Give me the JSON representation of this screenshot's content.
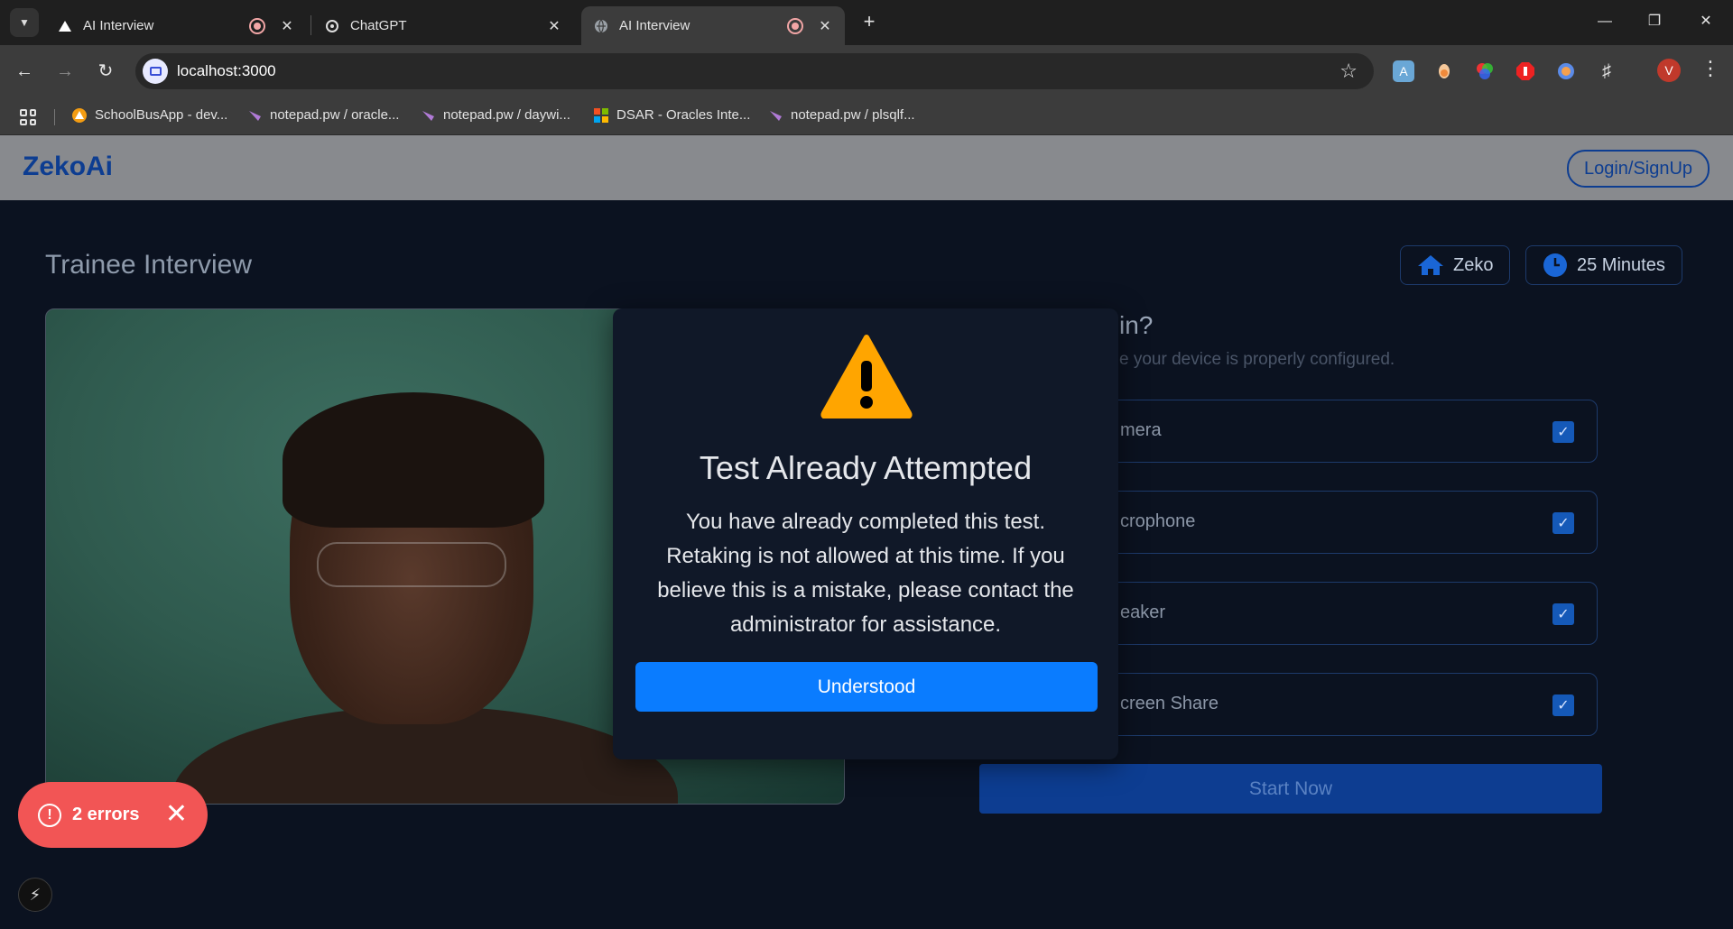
{
  "browser": {
    "tabs": [
      {
        "title": "AI Interview",
        "recording": true,
        "active": false
      },
      {
        "title": "ChatGPT",
        "recording": false,
        "active": false
      },
      {
        "title": "AI Interview",
        "recording": true,
        "active": true
      }
    ],
    "url": "localhost:3000",
    "profile_initial": "V",
    "bookmarks": [
      {
        "label": "SchoolBusApp - dev...",
        "icon": "warning-triangle-icon"
      },
      {
        "label": "notepad.pw / oracle...",
        "icon": "notepad-icon"
      },
      {
        "label": "notepad.pw / daywi...",
        "icon": "notepad-icon"
      },
      {
        "label": "DSAR - Oracles Inte...",
        "icon": "microsoft-icon"
      },
      {
        "label": "notepad.pw / plsqlf...",
        "icon": "notepad-icon"
      }
    ]
  },
  "app": {
    "brand": "ZekoAi",
    "login_label": "Login/SignUp",
    "page_title": "Trainee Interview",
    "company_chip": "Zeko",
    "duration_chip": "25 Minutes",
    "checklist": {
      "heading": "in?",
      "subtitle": "e your device is properly configured.",
      "items": [
        {
          "label": "mera",
          "checked": true
        },
        {
          "label": "crophone",
          "checked": true
        },
        {
          "label": "eaker",
          "checked": true
        },
        {
          "label": "creen Share",
          "checked": true
        }
      ]
    },
    "start_label": "Start Now"
  },
  "modal": {
    "title": "Test Already Attempted",
    "body": "You have already completed this test. Retaking is not allowed at this time. If you believe this is a mistake, please contact the administrator for assistance.",
    "button_label": "Understood"
  },
  "dev_overlay": {
    "errors_label": "2 errors"
  },
  "colors": {
    "brand": "#0d3d91",
    "primary_button": "#0a7cff",
    "error": "#f25555",
    "warning": "#ffa500"
  }
}
